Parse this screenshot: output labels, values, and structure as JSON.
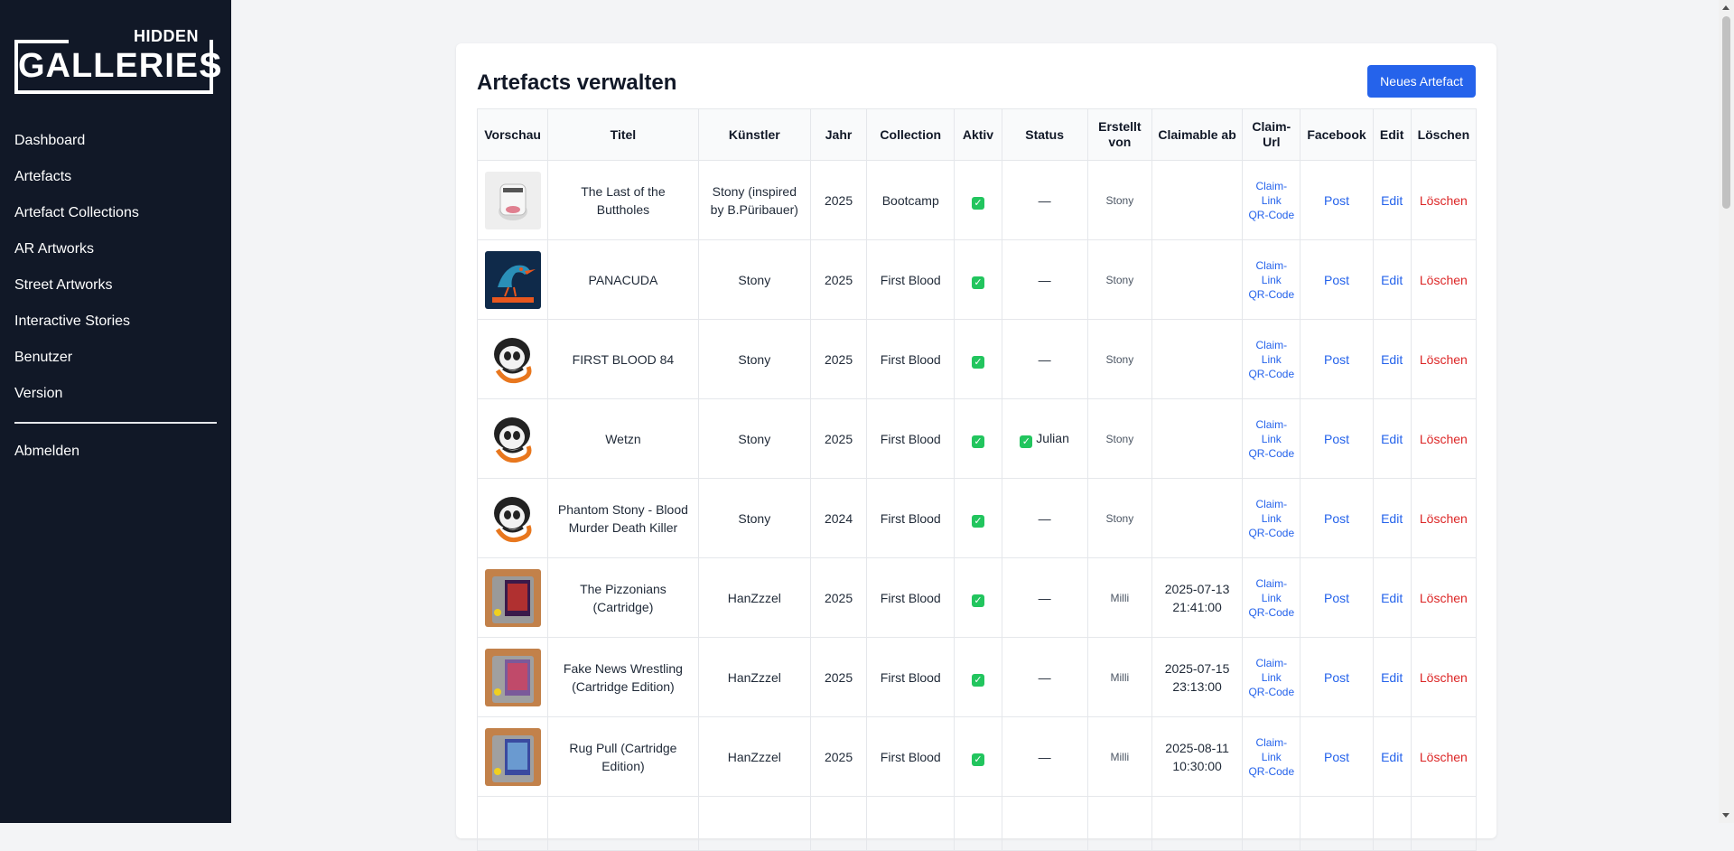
{
  "logo": {
    "line1": "HIDDEN",
    "line2": "GALLERIES"
  },
  "nav": {
    "items": [
      "Dashboard",
      "Artefacts",
      "Artefact Collections",
      "AR Artworks",
      "Street Artworks",
      "Interactive Stories",
      "Benutzer",
      "Version"
    ],
    "logout": "Abmelden"
  },
  "page": {
    "title": "Artefacts verwalten",
    "new_button": "Neues Artefact"
  },
  "table": {
    "headers": [
      "Vorschau",
      "Titel",
      "Künstler",
      "Jahr",
      "Collection",
      "Aktiv",
      "Status",
      "Erstellt von",
      "Claimable ab",
      "Claim-Url",
      "Facebook",
      "Edit",
      "Löschen"
    ],
    "claim_link": "Claim-Link",
    "qr_code": "QR-Code",
    "post_label": "Post",
    "edit_label": "Edit",
    "delete_label": "Löschen",
    "active_check": "✓",
    "rows": [
      {
        "thumb": "jar",
        "title": "The Last of the Buttholes",
        "artist": "Stony (inspired by B.Püribauer)",
        "year": "2025",
        "collection": "Bootcamp",
        "status": "—",
        "created_by": "Stony",
        "claimable": ""
      },
      {
        "thumb": "bird",
        "title": "PANACUDA",
        "artist": "Stony",
        "year": "2025",
        "collection": "First Blood",
        "status": "—",
        "created_by": "Stony",
        "claimable": ""
      },
      {
        "thumb": "skull",
        "title": "FIRST BLOOD 84",
        "artist": "Stony",
        "year": "2025",
        "collection": "First Blood",
        "status": "—",
        "created_by": "Stony",
        "claimable": ""
      },
      {
        "thumb": "skull",
        "title": "Wetzn",
        "artist": "Stony",
        "year": "2025",
        "collection": "First Blood",
        "status": "Julian",
        "status_checked": true,
        "created_by": "Stony",
        "claimable": ""
      },
      {
        "thumb": "skull",
        "title": "Phantom Stony - Blood Murder Death Killer",
        "artist": "Stony",
        "year": "2024",
        "collection": "First Blood",
        "status": "—",
        "created_by": "Stony",
        "claimable": ""
      },
      {
        "thumb": "cart1",
        "title": "The Pizzonians (Cartridge)",
        "artist": "HanZzzel",
        "year": "2025",
        "collection": "First Blood",
        "status": "—",
        "created_by": "Milli",
        "claimable": "2025-07-13 21:41:00"
      },
      {
        "thumb": "cart2",
        "title": "Fake News Wrestling (Cartridge Edition)",
        "artist": "HanZzzel",
        "year": "2025",
        "collection": "First Blood",
        "status": "—",
        "created_by": "Milli",
        "claimable": "2025-07-15 23:13:00"
      },
      {
        "thumb": "cart3",
        "title": "Rug Pull (Cartridge Edition)",
        "artist": "HanZzzel",
        "year": "2025",
        "collection": "First Blood",
        "status": "—",
        "created_by": "Milli",
        "claimable": "2025-08-11 10:30:00"
      }
    ]
  },
  "colors": {
    "sidebar": "#111827",
    "primary": "#2563eb",
    "danger": "#dc2626",
    "success": "#22c55e"
  }
}
